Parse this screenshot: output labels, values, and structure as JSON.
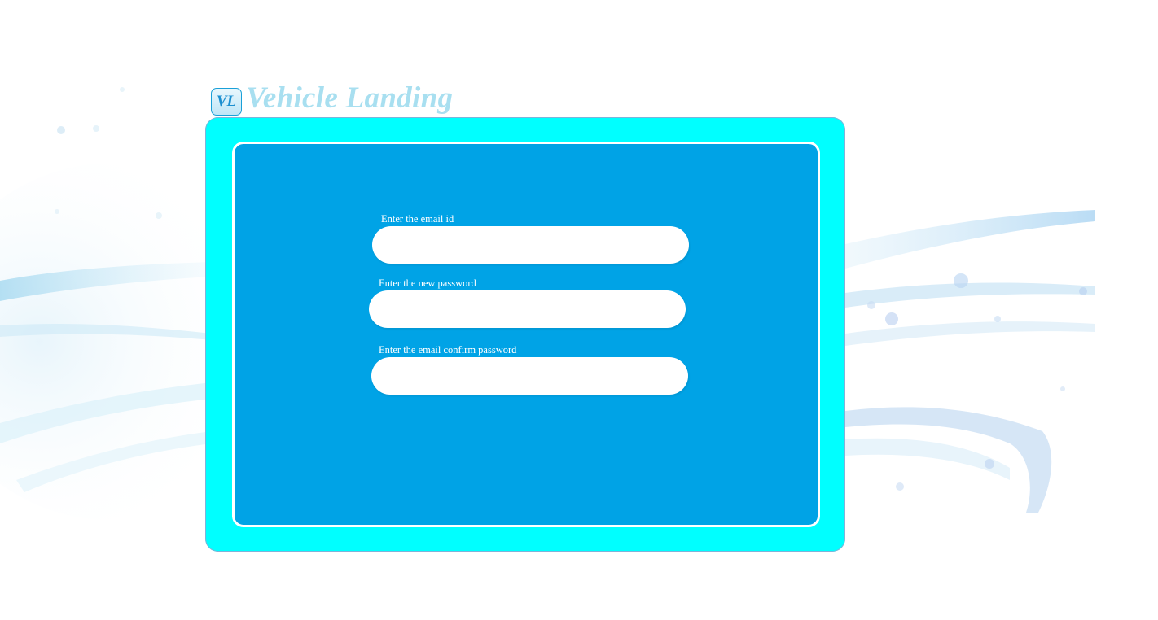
{
  "logo": {
    "badge": "VL",
    "title": "Vehicle Landing"
  },
  "form": {
    "email_label": "Enter the email id",
    "email_value": "",
    "new_password_label": "Enter the new password",
    "new_password_value": "",
    "confirm_password_label": "Enter the email confirm password",
    "confirm_password_value": ""
  },
  "colors": {
    "outer_frame": "#00ffff",
    "inner_panel": "#00a3e6",
    "logo_text": "#a8dff0",
    "logo_badge_text": "#1c8fd0"
  }
}
